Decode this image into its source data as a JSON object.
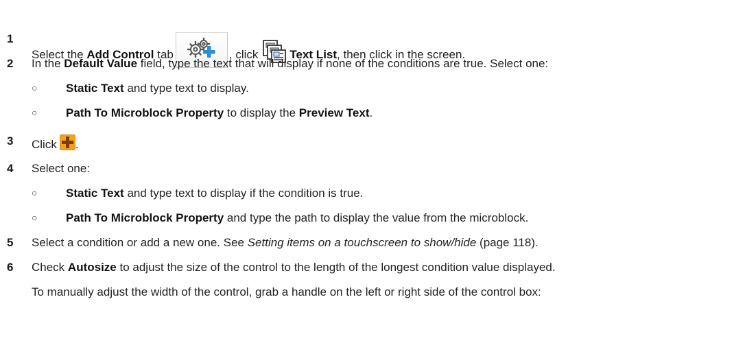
{
  "steps": [
    {
      "number": "1",
      "t1": "Select the ",
      "b1": "Add Control",
      "t2": " tab",
      "t3": ", click",
      "b2": "Text List",
      "t4": ", then click in the screen."
    },
    {
      "number": "2",
      "t1": "In the ",
      "b1": "Default Value",
      "t2": " field, type the text that will display if none of the conditions are true. Select one:",
      "options": [
        {
          "b1": "Static Text",
          "t1": " and type text to display."
        },
        {
          "b1": "Path To Microblock Property",
          "t1": " to display the ",
          "b2": "Preview Text",
          "t2": "."
        }
      ]
    },
    {
      "number": "3",
      "t1": "Click",
      "t2": "."
    },
    {
      "number": "4",
      "t1": "Select one:",
      "options": [
        {
          "b1": "Static Text",
          "t1": " and type text to display if the condition is true."
        },
        {
          "b1": "Path To Microblock Property",
          "t1": " and type the path to display the value from the microblock."
        }
      ]
    },
    {
      "number": "5",
      "t1": "Select a condition or add a new one. See ",
      "i1": "Setting items on a touchscreen to show/hide",
      "t2": " (page 118)."
    },
    {
      "number": "6",
      "t1": "Check ",
      "b1": "Autosize",
      "t2": " to adjust the size of the control to the length of the longest condition value displayed.",
      "p2": "To manually adjust the width of the control, grab a handle on the left or right side of the control box:"
    }
  ],
  "bullet": "○",
  "icons": {
    "add_control_tab": "gears-plus-icon",
    "text_list": "text-list-icon",
    "add": "add-plus-icon"
  },
  "colors": {
    "plus_blue": "#2a8fd6",
    "add_orange": "#f5a21a",
    "add_plus": "#7a3e0a"
  }
}
